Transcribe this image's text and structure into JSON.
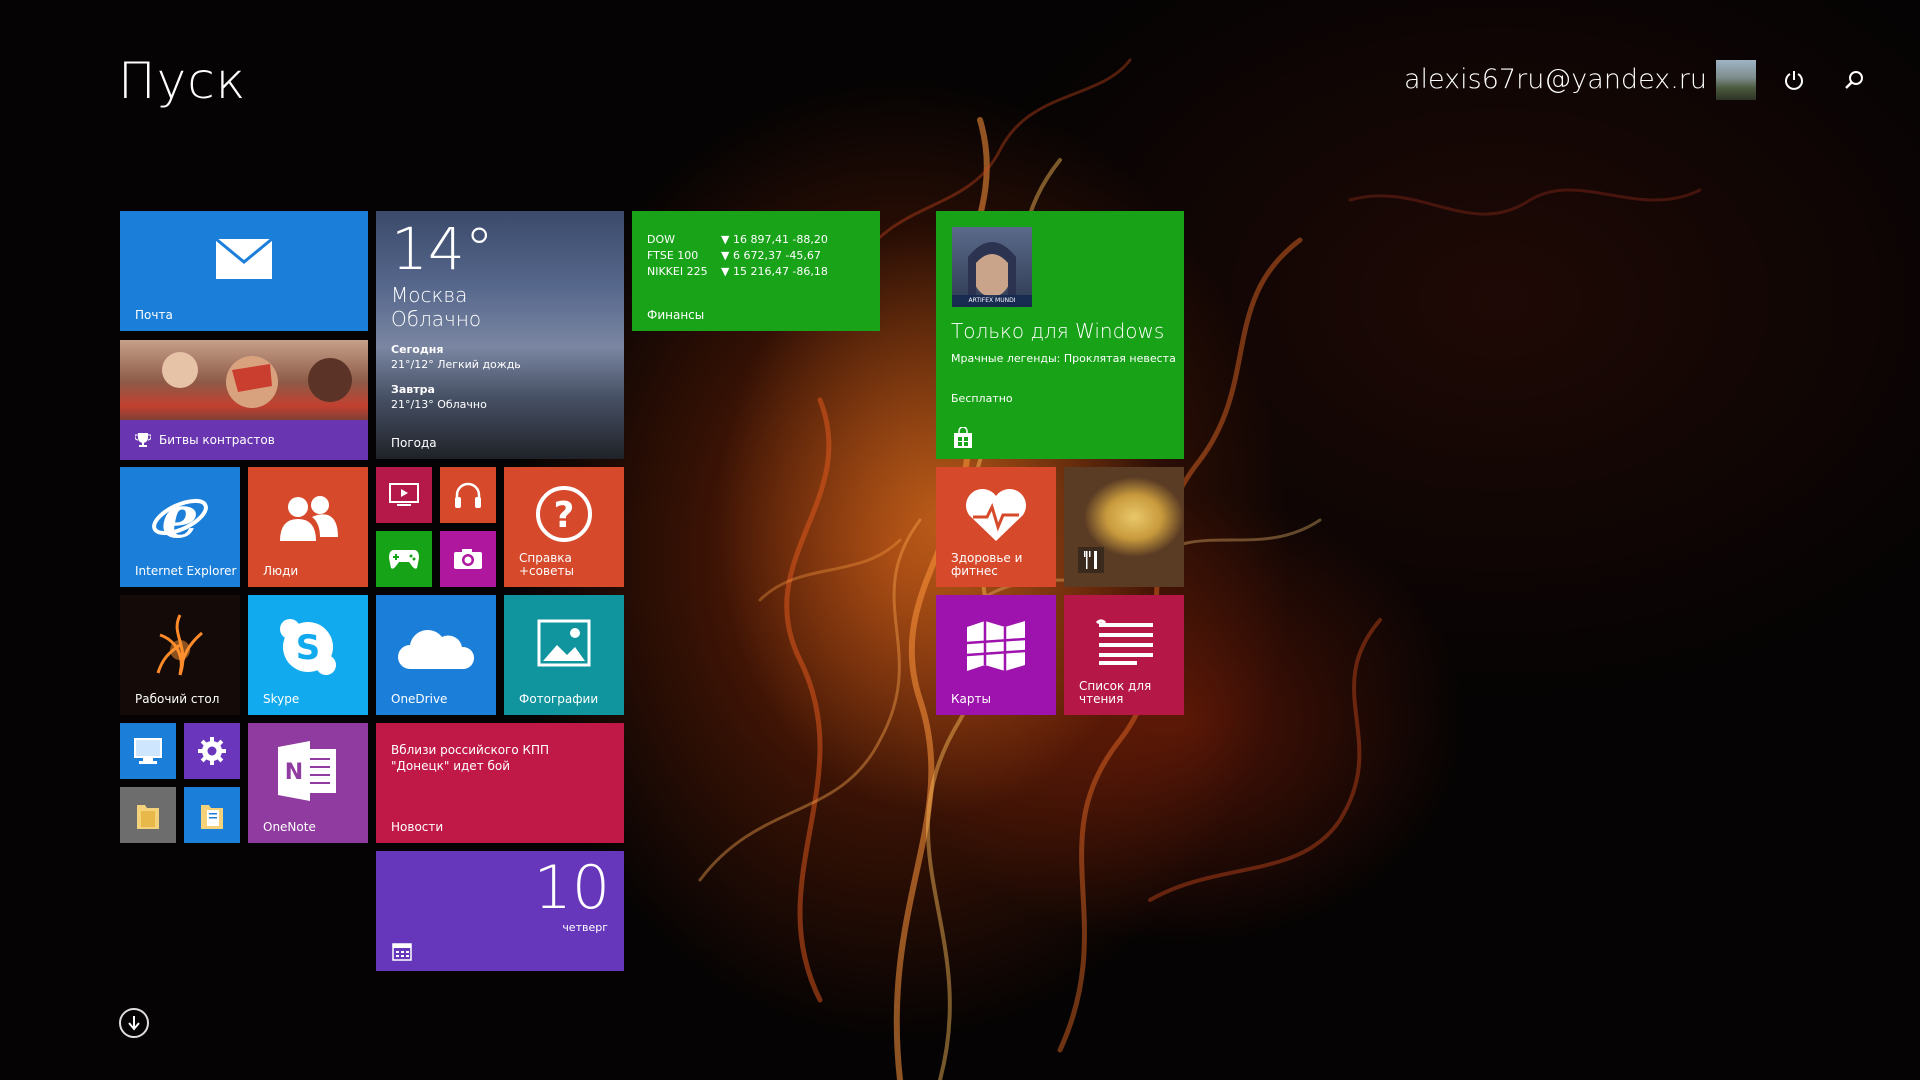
{
  "header": {
    "title": "Пуск",
    "user_email": "alexis67ru@yandex.ru",
    "power_icon": "power-icon",
    "search_icon": "search-icon"
  },
  "tiles": {
    "mail": {
      "label": "Почта"
    },
    "battle": {
      "label": "Битвы контрастов"
    },
    "weather": {
      "temp": "14°",
      "city": "Москва",
      "condition": "Облачно",
      "today_label": "Сегодня",
      "today_forecast": "21°/12° Легкий дождь",
      "tomorrow_label": "Завтра",
      "tomorrow_forecast": "21°/13° Облачно",
      "label": "Погода"
    },
    "finance": {
      "rows": [
        {
          "name": "DOW",
          "value": "▼ 16 897,41 -88,20"
        },
        {
          "name": "FTSE 100",
          "value": "▼ 6 672,37 -45,67"
        },
        {
          "name": "NIKKEI 225",
          "value": "▼ 15 216,47 -86,18"
        }
      ],
      "label": "Финансы"
    },
    "store": {
      "headline": "Только для Windows",
      "app": "Мрачные легенды: Проклятая невеста",
      "price": "Бесплатно",
      "badge": "ARTIFEX MUNDI"
    },
    "ie": {
      "label": "Internet Explorer"
    },
    "people": {
      "label": "Люди"
    },
    "help": {
      "label": "Справка +советы"
    },
    "health": {
      "label": "Здоровье и фитнес"
    },
    "desktop": {
      "label": "Рабочий стол"
    },
    "skype": {
      "label": "Skype"
    },
    "onedrive": {
      "label": "OneDrive"
    },
    "photos": {
      "label": "Фотографии"
    },
    "maps": {
      "label": "Карты"
    },
    "reading": {
      "label": "Список для чтения"
    },
    "onenote": {
      "label": "OneNote"
    },
    "news": {
      "headline": "Вблизи российского КПП \"Донецк\" идет бой",
      "label": "Новости"
    },
    "calendar": {
      "day": "10",
      "weekday": "четверг"
    }
  },
  "colors": {
    "blue": "#1b7fd9",
    "green": "#18a218",
    "orange": "#d6492b",
    "purple": "#6737bb",
    "magenta": "#b0179f",
    "crimson": "#c01947"
  }
}
